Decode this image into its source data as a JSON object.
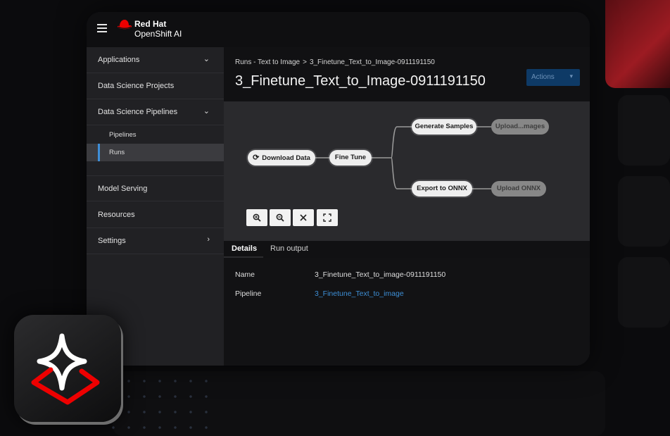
{
  "brand": {
    "line1": "Red Hat",
    "line2": "OpenShift AI",
    "accent": "#ee0000"
  },
  "sidebar": {
    "items": [
      {
        "label": "Applications",
        "chevron": "chevron-down"
      },
      {
        "label": "Data Science Projects"
      },
      {
        "label": "Data Science Pipelines",
        "chevron": "chevron-down"
      },
      {
        "label": "Model Serving"
      },
      {
        "label": "Resources"
      },
      {
        "label": "Settings",
        "chevron": "chevron-right"
      }
    ],
    "subitems": [
      {
        "label": "Pipelines"
      },
      {
        "label": "Runs",
        "active": true
      }
    ]
  },
  "header": {
    "breadcrumb": {
      "parent": "Runs - Text to Image",
      "separator": ">",
      "current": "3_Finetune_Text_to_Image-0911191150"
    },
    "title": "3_Finetune_Text_to_Image-0911191150",
    "actions_label": "Actions"
  },
  "graph": {
    "nodes": [
      {
        "label": "Download Data",
        "status": "running"
      },
      {
        "label": "Fine Tune"
      },
      {
        "label": "Generate Samples"
      },
      {
        "label": "Upload...mages",
        "dim": true
      },
      {
        "label": "Export to ONNX"
      },
      {
        "label": "Upload ONNX",
        "dim": true
      }
    ],
    "controls": [
      "zoom-in-icon",
      "zoom-out-icon",
      "fit-to-screen-icon",
      "expand-icon"
    ]
  },
  "tabs": [
    {
      "label": "Details",
      "active": true
    },
    {
      "label": "Run output"
    }
  ],
  "details": {
    "name_label": "Name",
    "name_value": "3_Finetune_Text_to_image-0911191150",
    "pipeline_label": "Pipeline",
    "pipeline_value": "3_Finetune_Text_to_image"
  },
  "colors": {
    "link": "#3d8fd6",
    "active_marker": "#3e8ed7",
    "primary_button": "#0e3a66"
  }
}
